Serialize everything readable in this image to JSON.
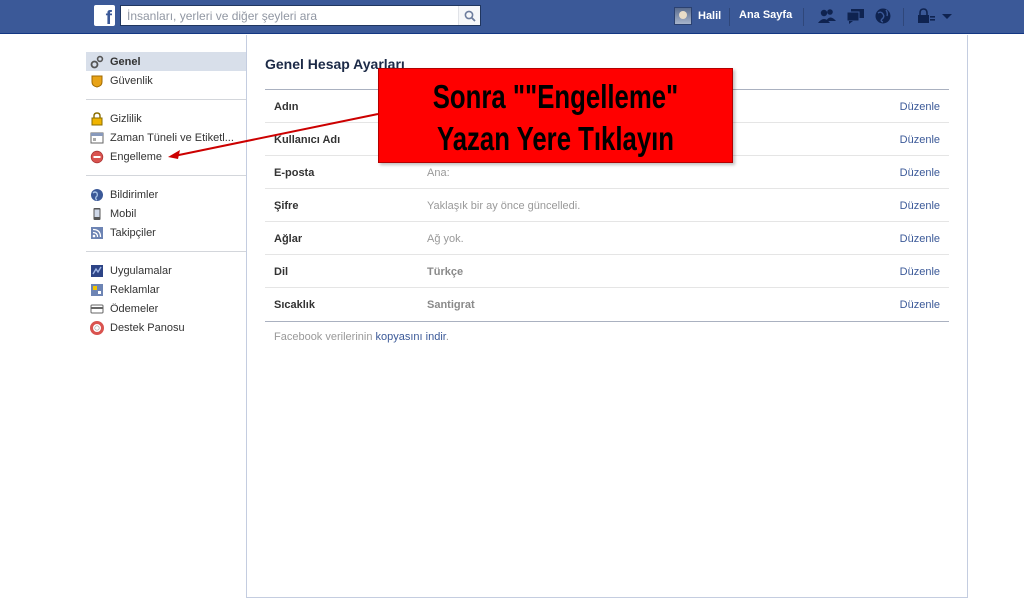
{
  "topbar": {
    "logo_letter": "f",
    "search_placeholder": "İnsanları, yerleri ve diğer şeyleri ara",
    "user_name": "Halil",
    "home_label": "Ana Sayfa",
    "jewels": [
      "friend-requests-icon",
      "messages-icon",
      "notifications-icon",
      "lock-icon",
      "menu-chevron-icon"
    ],
    "colors": {
      "bar": "#3b5998",
      "border": "#133783"
    }
  },
  "leftnav": {
    "groups": [
      {
        "items": [
          {
            "label": "Genel",
            "icon": "gear-icon",
            "active": true
          },
          {
            "label": "Güvenlik",
            "icon": "shield-icon",
            "active": false
          }
        ]
      },
      {
        "items": [
          {
            "label": "Gizlilik",
            "icon": "lock-icon",
            "active": false
          },
          {
            "label": "Zaman Tüneli ve Etiketl...",
            "icon": "timeline-icon",
            "active": false
          },
          {
            "label": "Engelleme",
            "icon": "block-icon",
            "active": false
          }
        ]
      },
      {
        "items": [
          {
            "label": "Bildirimler",
            "icon": "globe-icon",
            "active": false
          },
          {
            "label": "Mobil",
            "icon": "mobile-icon",
            "active": false
          },
          {
            "label": "Takipçiler",
            "icon": "rss-icon",
            "active": false
          }
        ]
      },
      {
        "items": [
          {
            "label": "Uygulamalar",
            "icon": "apps-icon",
            "active": false
          },
          {
            "label": "Reklamlar",
            "icon": "ads-icon",
            "active": false
          },
          {
            "label": "Ödemeler",
            "icon": "payments-icon",
            "active": false
          },
          {
            "label": "Destek Panosu",
            "icon": "lifebuoy-icon",
            "active": false
          }
        ]
      }
    ]
  },
  "main": {
    "title": "Genel Hesap Ayarları",
    "rows": [
      {
        "label": "Adın",
        "value": "",
        "bold_value": false,
        "edit": "Düzenle"
      },
      {
        "label": "Kullanıcı Adı",
        "value": "",
        "bold_value": false,
        "edit": "Düzenle"
      },
      {
        "label": "E-posta",
        "value": "Ana:",
        "bold_value": false,
        "edit": "Düzenle"
      },
      {
        "label": "Şifre",
        "value": "Yaklaşık bir ay önce güncelledi.",
        "bold_value": false,
        "edit": "Düzenle"
      },
      {
        "label": "Ağlar",
        "value": "Ağ yok.",
        "bold_value": false,
        "edit": "Düzenle"
      },
      {
        "label": "Dil",
        "value": "Türkçe",
        "bold_value": true,
        "edit": "Düzenle"
      },
      {
        "label": "Sıcaklık",
        "value": "Santigrat",
        "bold_value": true,
        "edit": "Düzenle"
      }
    ],
    "footer_prefix": "Facebook verilerinin ",
    "footer_link": "kopyasını indir",
    "footer_suffix": "."
  },
  "callout": {
    "line1": "Sonra \"\"Engelleme\"",
    "line2": "Yazan Yere Tıklayın",
    "color": "#ff0000",
    "arrow_color": "#cc0000"
  }
}
